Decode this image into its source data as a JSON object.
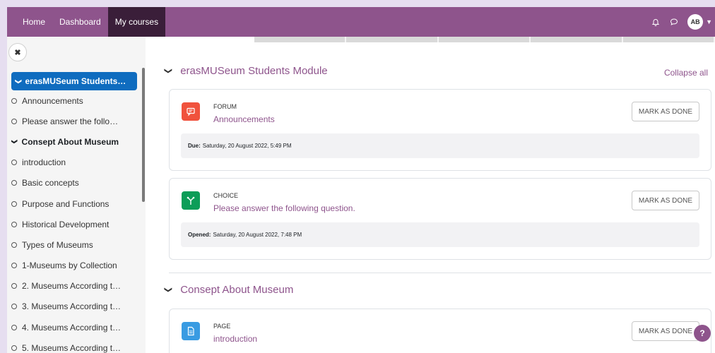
{
  "navbar": {
    "links": [
      "Home",
      "Dashboard",
      "My courses"
    ],
    "avatar_initials": "AB",
    "icons": [
      "bell-icon",
      "chat-icon",
      "chevron-down-icon"
    ]
  },
  "drawer": {
    "close_icon": "close-icon",
    "section1": "erasMUSeum Students…",
    "items": [
      "Announcements",
      "Please answer the follo…"
    ],
    "section2": "Consept About Museum",
    "items2": [
      "introduction",
      "Basic concepts",
      "Purpose and Functions",
      "Historical Development",
      "Types of Museums",
      "1-Museums by Collection",
      "2. Museums According t…",
      "3. Museums According t…",
      "4. Museums According t…",
      "5. Museums According t…"
    ]
  },
  "main": {
    "section1_title": "erasMUSeum Students Module",
    "collapse_all": "Collapse all",
    "activities": [
      {
        "type": "FORUM",
        "name": "Announcements",
        "button": "MARK AS DONE",
        "date_label": "Due:",
        "date": "Saturday, 20 August 2022, 5:49 PM",
        "color": "#f0523d"
      },
      {
        "type": "CHOICE",
        "name": "Please answer the following question.",
        "button": "MARK AS DONE",
        "date_label": "Opened:",
        "date": "Saturday, 20 August 2022, 7:48 PM",
        "color": "#0d9d58"
      }
    ],
    "section2_title": "Consept About Museum",
    "page_activity": {
      "type": "PAGE",
      "name": "introduction",
      "button": "MARK AS DONE",
      "color": "#399be2"
    }
  },
  "help": "?"
}
